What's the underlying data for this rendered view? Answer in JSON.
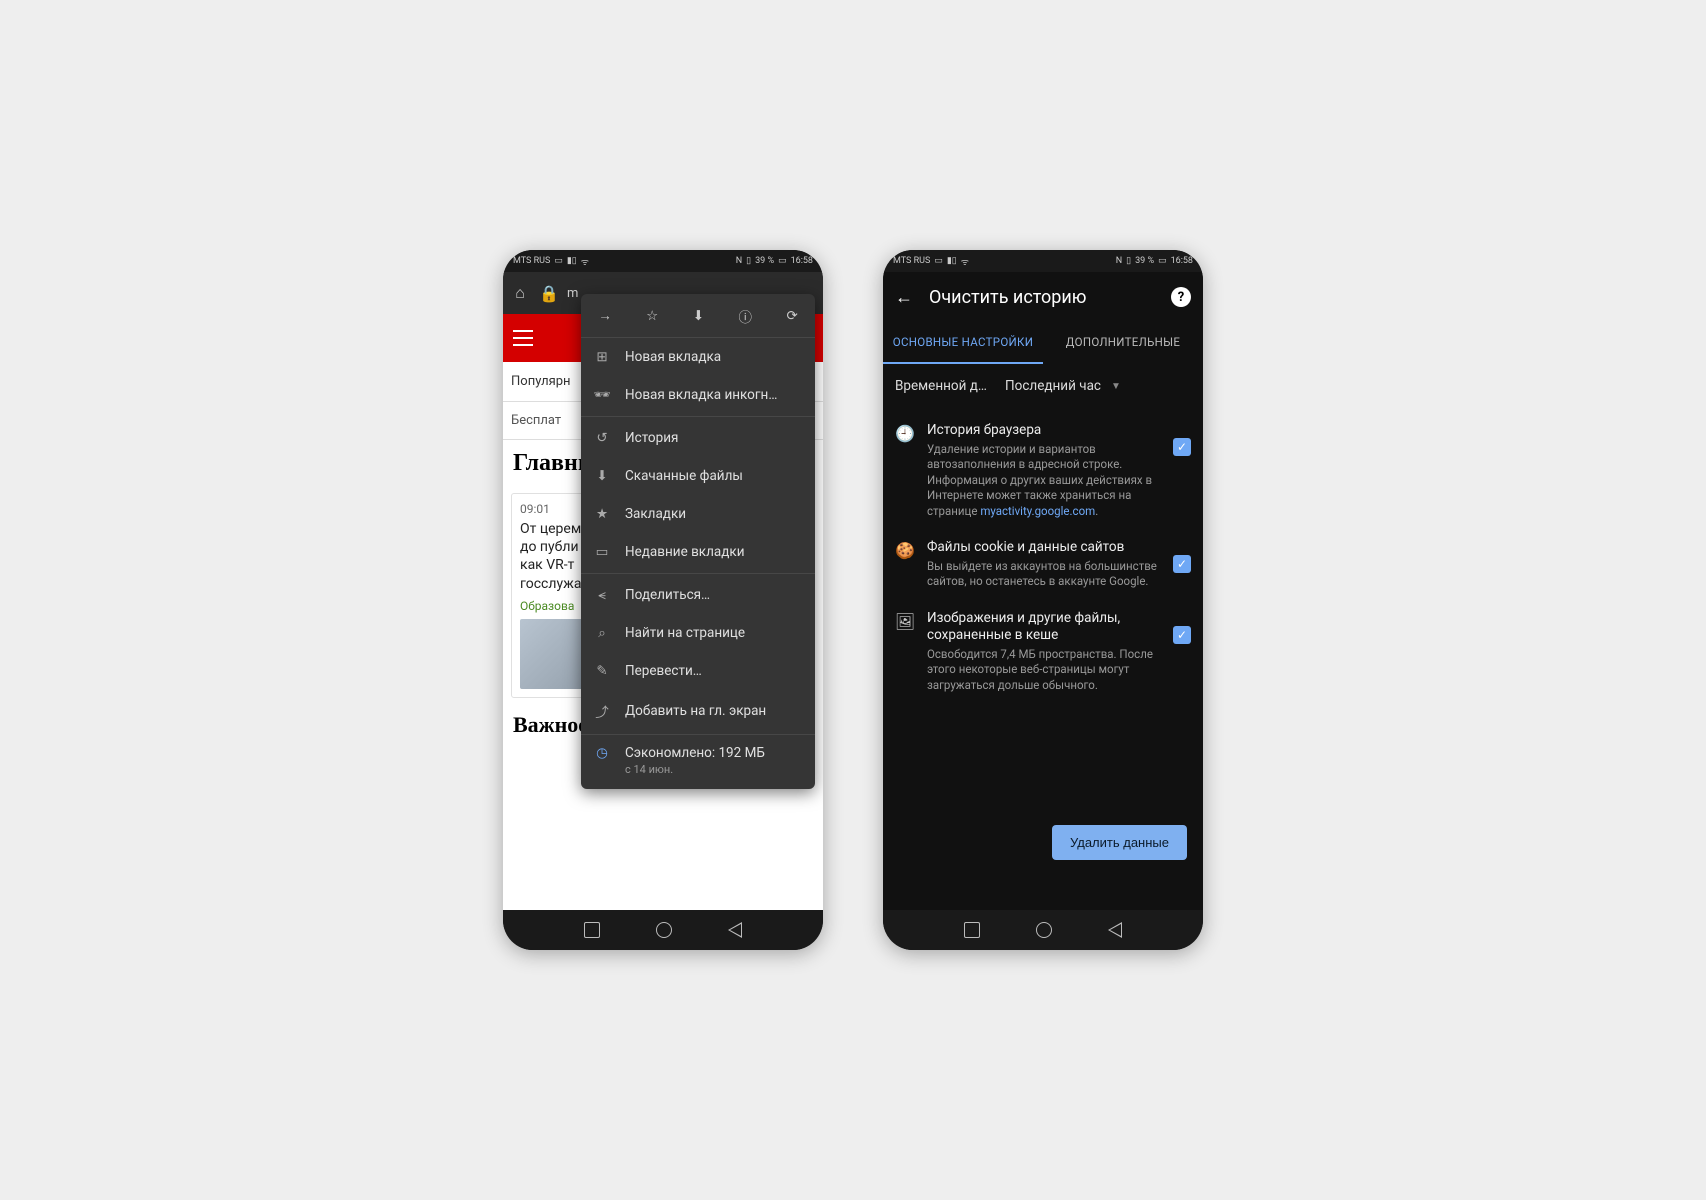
{
  "status_bar": {
    "carrier": "MTS RUS",
    "battery": "39 %",
    "time": "16:58"
  },
  "phone1": {
    "url_fragment": "m",
    "page": {
      "tab1": "Популярн",
      "tab2": "Бесплат",
      "heading": "Главны",
      "article": {
        "time": "09:01",
        "title": "От церемо\nдо публи\nкак VR-т\nгосслужа",
        "tag": "Образова"
      },
      "heading2": "Важное"
    },
    "menu": {
      "items": [
        {
          "label": "Новая вкладка"
        },
        {
          "label": "Новая вкладка инкогн…"
        },
        {
          "label": "История"
        },
        {
          "label": "Скачанные файлы"
        },
        {
          "label": "Закладки"
        },
        {
          "label": "Недавние вкладки"
        },
        {
          "label": "Поделиться…"
        },
        {
          "label": "Найти на странице"
        },
        {
          "label": "Перевести…"
        },
        {
          "label": "Добавить на гл. экран"
        }
      ],
      "saved": {
        "main": "Сэкономлено: 192 МБ",
        "sub": "с 14 июн."
      }
    }
  },
  "phone2": {
    "title": "Очистить историю",
    "tabs": {
      "basic": "ОСНОВНЫЕ НАСТРОЙКИ",
      "advanced": "ДОПОЛНИТЕЛЬНЫЕ"
    },
    "time_range": {
      "label": "Временной д…",
      "value": "Последний час"
    },
    "items": [
      {
        "title": "История браузера",
        "desc": "Удаление истории и вариантов автозаполнения в адресной строке. Информация о других ваших действиях в Интернете может также храниться на странице ",
        "link": "myactivity.google.com",
        "checked": true
      },
      {
        "title": "Файлы cookie и данные сайтов",
        "desc": "Вы выйдете из аккаунтов на большинстве сайтов, но останетесь в аккаунте Google.",
        "checked": true
      },
      {
        "title": "Изображения и другие файлы, сохраненные в кеше",
        "desc": "Освободится 7,4 МБ пространства. После этого некоторые веб-страницы могут загружаться дольше обычного.",
        "checked": true
      }
    ],
    "delete_btn": "Удалить данные"
  }
}
